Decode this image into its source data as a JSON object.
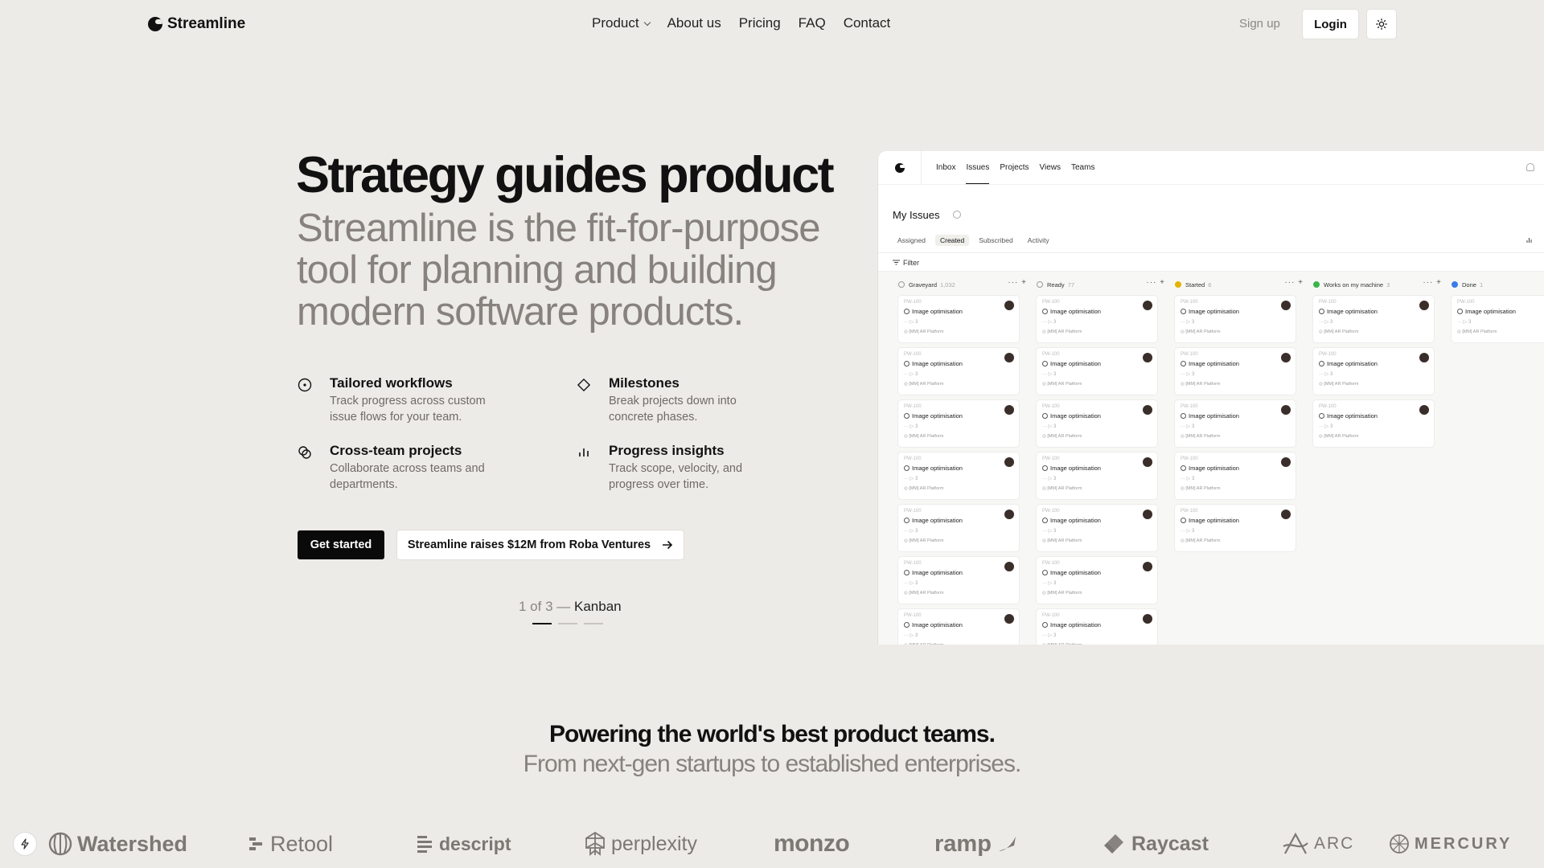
{
  "nav": {
    "brand": "Streamline",
    "links": [
      "Product",
      "About us",
      "Pricing",
      "FAQ",
      "Contact"
    ],
    "signup": "Sign up",
    "login": "Login",
    "theme_icon": "sun-icon"
  },
  "hero": {
    "title": "Strategy guides product",
    "subtitle": "Streamline is the fit-for-purpose tool for planning and building modern software products.",
    "features": [
      {
        "title": "Tailored workflows",
        "desc": "Track progress across custom issue flows for your team.",
        "icon": "circle-dot-icon"
      },
      {
        "title": "Milestones",
        "desc": "Break projects down into concrete phases.",
        "icon": "diamond-icon"
      },
      {
        "title": "Cross-team projects",
        "desc": "Collaborate across teams and departments.",
        "icon": "overlap-circles-icon"
      },
      {
        "title": "Progress insights",
        "desc": "Track scope, velocity, and progress over time.",
        "icon": "bar-chart-icon"
      }
    ],
    "cta_primary": "Get started",
    "cta_secondary": "Streamline raises $12M from Roba Ventures",
    "carousel_count": "1 of 3 —",
    "carousel_label": "Kanban",
    "carousel_active": 1,
    "carousel_total": 3
  },
  "app": {
    "tabs": [
      "Inbox",
      "Issues",
      "Projects",
      "Views",
      "Teams"
    ],
    "active_tab": "Issues",
    "heading": "My Issues",
    "subtabs": [
      "Assigned",
      "Created",
      "Subscribed",
      "Activity"
    ],
    "active_subtab": "Created",
    "filter": "Filter",
    "card": {
      "id": "PW-100",
      "title": "Image optimisation",
      "meta": "··· ▷ 3",
      "tag": "[MM] AR Platform"
    },
    "columns": [
      {
        "name": "Graveyard",
        "count": "1,032",
        "color": "#9a9a9a",
        "cards": 7
      },
      {
        "name": "Ready",
        "count": "77",
        "color": "#9a9a9a",
        "cards": 7
      },
      {
        "name": "Started",
        "count": "6",
        "color": "#e2b400",
        "cards": 5
      },
      {
        "name": "Works on my machine",
        "count": "3",
        "color": "#3bb54a",
        "cards": 3
      },
      {
        "name": "Done",
        "count": "1",
        "color": "#3b7de8",
        "cards": 1
      }
    ]
  },
  "social": {
    "headline": "Powering the world's best product teams.",
    "subheadline": "From next-gen startups to established enterprises.",
    "brands": [
      "Watershed",
      "Retool",
      "descript",
      "perplexity",
      "monzo",
      "ramp",
      "Raycast",
      "ARC",
      "MERCURY"
    ]
  }
}
